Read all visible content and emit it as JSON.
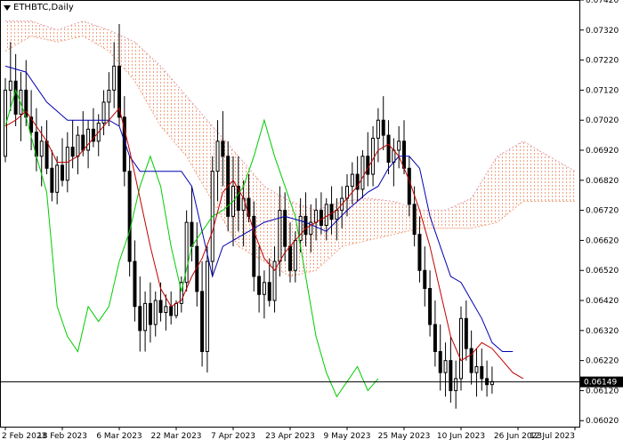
{
  "chart_data": {
    "type": "candlestick",
    "symbol_label": "ETHBTC,Daily",
    "current_price_label": "0.06149",
    "current_price": 0.06149,
    "ylim": [
      0.06,
      0.0742
    ],
    "y_ticks": [
      "0.07420",
      "0.07320",
      "0.07220",
      "0.07120",
      "0.07020",
      "0.06920",
      "0.06820",
      "0.06720",
      "0.06620",
      "0.06520",
      "0.06420",
      "0.06320",
      "0.06220",
      "0.06120",
      "0.06020"
    ],
    "x_ticks": [
      "2 Feb 2023",
      "18 Feb 2023",
      "6 Mar 2023",
      "22 Mar 2023",
      "7 Apr 2023",
      "23 Apr 2023",
      "9 May 2023",
      "25 May 2023",
      "10 Jun 2023",
      "26 Jun 2023",
      "12 Jul 2023"
    ],
    "x_tick_index": [
      0,
      11,
      22,
      33,
      44,
      55,
      66,
      77,
      88,
      99,
      110
    ],
    "colors": {
      "candle": "#000000",
      "tenkan": "#c00000",
      "kijun": "#0000b0",
      "chikou": "#00cc00",
      "cloud_a": "#f0a080",
      "cloud_b": "#e0a0b0"
    },
    "candles": [
      [
        0.069,
        0.0716,
        0.0688,
        0.0712
      ],
      [
        0.0712,
        0.0728,
        0.0705,
        0.0715
      ],
      [
        0.0715,
        0.0724,
        0.07,
        0.0704
      ],
      [
        0.0704,
        0.0718,
        0.0695,
        0.0712
      ],
      [
        0.0712,
        0.0722,
        0.07,
        0.0703
      ],
      [
        0.0703,
        0.0712,
        0.0692,
        0.0698
      ],
      [
        0.0698,
        0.0706,
        0.0685,
        0.069
      ],
      [
        0.069,
        0.07,
        0.068,
        0.0695
      ],
      [
        0.0695,
        0.0702,
        0.0684,
        0.0686
      ],
      [
        0.0686,
        0.0692,
        0.0675,
        0.0678
      ],
      [
        0.0678,
        0.069,
        0.0674,
        0.0687
      ],
      [
        0.0687,
        0.0696,
        0.068,
        0.0682
      ],
      [
        0.0682,
        0.0698,
        0.0678,
        0.0693
      ],
      [
        0.0693,
        0.0702,
        0.0686,
        0.069
      ],
      [
        0.069,
        0.07,
        0.0684,
        0.0697
      ],
      [
        0.0697,
        0.0705,
        0.069,
        0.0692
      ],
      [
        0.0692,
        0.0702,
        0.0686,
        0.0699
      ],
      [
        0.0699,
        0.0706,
        0.0693,
        0.0695
      ],
      [
        0.0695,
        0.0704,
        0.069,
        0.0701
      ],
      [
        0.0701,
        0.0712,
        0.0697,
        0.0708
      ],
      [
        0.0708,
        0.0718,
        0.07,
        0.0712
      ],
      [
        0.0712,
        0.0728,
        0.0706,
        0.072
      ],
      [
        0.072,
        0.0734,
        0.07,
        0.0703
      ],
      [
        0.0703,
        0.071,
        0.068,
        0.0685
      ],
      [
        0.0685,
        0.069,
        0.065,
        0.0655
      ],
      [
        0.0655,
        0.0662,
        0.0635,
        0.064
      ],
      [
        0.064,
        0.065,
        0.0625,
        0.0632
      ],
      [
        0.0632,
        0.0645,
        0.0625,
        0.0641
      ],
      [
        0.0641,
        0.0648,
        0.0628,
        0.0634
      ],
      [
        0.0634,
        0.0645,
        0.063,
        0.0642
      ],
      [
        0.0642,
        0.0648,
        0.0635,
        0.0638
      ],
      [
        0.0638,
        0.0644,
        0.0632,
        0.064
      ],
      [
        0.064,
        0.0645,
        0.0634,
        0.0637
      ],
      [
        0.0637,
        0.0642,
        0.0636,
        0.0641
      ],
      [
        0.0641,
        0.065,
        0.0638,
        0.0648
      ],
      [
        0.0648,
        0.0672,
        0.0645,
        0.0668
      ],
      [
        0.0668,
        0.068,
        0.0655,
        0.066
      ],
      [
        0.066,
        0.0668,
        0.064,
        0.0645
      ],
      [
        0.0645,
        0.0655,
        0.062,
        0.0625
      ],
      [
        0.0625,
        0.066,
        0.0618,
        0.0655
      ],
      [
        0.0655,
        0.069,
        0.065,
        0.0685
      ],
      [
        0.0685,
        0.0702,
        0.0675,
        0.0695
      ],
      [
        0.0695,
        0.0705,
        0.068,
        0.069
      ],
      [
        0.069,
        0.0695,
        0.0665,
        0.067
      ],
      [
        0.067,
        0.069,
        0.066,
        0.068
      ],
      [
        0.068,
        0.069,
        0.0665,
        0.0672
      ],
      [
        0.0672,
        0.0682,
        0.066,
        0.0676
      ],
      [
        0.0676,
        0.0684,
        0.0668,
        0.067
      ],
      [
        0.067,
        0.0675,
        0.0645,
        0.065
      ],
      [
        0.065,
        0.066,
        0.0638,
        0.0644
      ],
      [
        0.0644,
        0.0652,
        0.0636,
        0.0648
      ],
      [
        0.0648,
        0.0656,
        0.064,
        0.0642
      ],
      [
        0.0642,
        0.066,
        0.0638,
        0.0655
      ],
      [
        0.0655,
        0.068,
        0.065,
        0.0672
      ],
      [
        0.0672,
        0.0678,
        0.0655,
        0.066
      ],
      [
        0.066,
        0.0668,
        0.0648,
        0.0652
      ],
      [
        0.0652,
        0.0665,
        0.0648,
        0.0662
      ],
      [
        0.0662,
        0.0676,
        0.0658,
        0.067
      ],
      [
        0.067,
        0.0678,
        0.066,
        0.0664
      ],
      [
        0.0664,
        0.0674,
        0.0658,
        0.0668
      ],
      [
        0.0668,
        0.0676,
        0.0662,
        0.0672
      ],
      [
        0.0672,
        0.0678,
        0.0664,
        0.0667
      ],
      [
        0.0667,
        0.0676,
        0.0662,
        0.0674
      ],
      [
        0.0674,
        0.068,
        0.0664,
        0.0669
      ],
      [
        0.0669,
        0.0676,
        0.0662,
        0.0672
      ],
      [
        0.0672,
        0.068,
        0.0666,
        0.0676
      ],
      [
        0.0676,
        0.0684,
        0.067,
        0.068
      ],
      [
        0.068,
        0.0688,
        0.0674,
        0.0684
      ],
      [
        0.0684,
        0.069,
        0.0675,
        0.0679
      ],
      [
        0.0679,
        0.0692,
        0.0676,
        0.069
      ],
      [
        0.069,
        0.0698,
        0.068,
        0.0684
      ],
      [
        0.0684,
        0.07,
        0.068,
        0.0696
      ],
      [
        0.0696,
        0.0706,
        0.0688,
        0.0702
      ],
      [
        0.0702,
        0.071,
        0.0692,
        0.0697
      ],
      [
        0.0697,
        0.0702,
        0.0684,
        0.0688
      ],
      [
        0.0688,
        0.0696,
        0.068,
        0.0692
      ],
      [
        0.0692,
        0.07,
        0.0686,
        0.0695
      ],
      [
        0.0695,
        0.0702,
        0.0684,
        0.0686
      ],
      [
        0.0686,
        0.069,
        0.067,
        0.0674
      ],
      [
        0.0674,
        0.068,
        0.066,
        0.0664
      ],
      [
        0.0664,
        0.067,
        0.0648,
        0.0652
      ],
      [
        0.0652,
        0.066,
        0.064,
        0.0646
      ],
      [
        0.0646,
        0.0652,
        0.063,
        0.0634
      ],
      [
        0.0634,
        0.0642,
        0.062,
        0.0625
      ],
      [
        0.0625,
        0.0634,
        0.0612,
        0.0618
      ],
      [
        0.0618,
        0.0628,
        0.061,
        0.0622
      ],
      [
        0.0622,
        0.063,
        0.0608,
        0.0612
      ],
      [
        0.0612,
        0.0622,
        0.0606,
        0.0616
      ],
      [
        0.0616,
        0.064,
        0.0612,
        0.0636
      ],
      [
        0.0636,
        0.0642,
        0.0622,
        0.0626
      ],
      [
        0.0626,
        0.0632,
        0.0614,
        0.0618
      ],
      [
        0.0618,
        0.0626,
        0.061,
        0.062
      ],
      [
        0.062,
        0.0626,
        0.0612,
        0.0616
      ],
      [
        0.0616,
        0.0622,
        0.061,
        0.0614
      ],
      [
        0.0614,
        0.062,
        0.0611,
        0.0615
      ]
    ],
    "tenkan": [
      [
        0,
        0.07
      ],
      [
        2,
        0.0702
      ],
      [
        4,
        0.0705
      ],
      [
        6,
        0.07
      ],
      [
        8,
        0.0695
      ],
      [
        10,
        0.0688
      ],
      [
        12,
        0.0688
      ],
      [
        14,
        0.069
      ],
      [
        16,
        0.0694
      ],
      [
        18,
        0.0698
      ],
      [
        20,
        0.0702
      ],
      [
        22,
        0.0706
      ],
      [
        24,
        0.0692
      ],
      [
        26,
        0.0676
      ],
      [
        28,
        0.066
      ],
      [
        30,
        0.0646
      ],
      [
        32,
        0.064
      ],
      [
        34,
        0.0642
      ],
      [
        36,
        0.065
      ],
      [
        38,
        0.0656
      ],
      [
        40,
        0.0665
      ],
      [
        42,
        0.0678
      ],
      [
        44,
        0.0682
      ],
      [
        46,
        0.0676
      ],
      [
        48,
        0.0665
      ],
      [
        50,
        0.0656
      ],
      [
        52,
        0.0652
      ],
      [
        54,
        0.0658
      ],
      [
        56,
        0.0662
      ],
      [
        58,
        0.0666
      ],
      [
        60,
        0.0668
      ],
      [
        62,
        0.067
      ],
      [
        64,
        0.0672
      ],
      [
        66,
        0.0676
      ],
      [
        68,
        0.068
      ],
      [
        70,
        0.0686
      ],
      [
        72,
        0.0692
      ],
      [
        74,
        0.0694
      ],
      [
        76,
        0.069
      ],
      [
        78,
        0.0682
      ],
      [
        80,
        0.0672
      ],
      [
        82,
        0.066
      ],
      [
        84,
        0.0645
      ],
      [
        86,
        0.063
      ],
      [
        88,
        0.0622
      ],
      [
        90,
        0.0624
      ],
      [
        92,
        0.0628
      ],
      [
        94,
        0.0626
      ],
      [
        96,
        0.0622
      ],
      [
        98,
        0.0618
      ],
      [
        100,
        0.0616
      ]
    ],
    "kijun": [
      [
        0,
        0.072
      ],
      [
        4,
        0.0718
      ],
      [
        8,
        0.0708
      ],
      [
        12,
        0.0702
      ],
      [
        16,
        0.0702
      ],
      [
        20,
        0.0702
      ],
      [
        22,
        0.07
      ],
      [
        24,
        0.069
      ],
      [
        26,
        0.0685
      ],
      [
        30,
        0.0685
      ],
      [
        34,
        0.0685
      ],
      [
        36,
        0.068
      ],
      [
        38,
        0.0665
      ],
      [
        40,
        0.065
      ],
      [
        42,
        0.066
      ],
      [
        46,
        0.0664
      ],
      [
        50,
        0.0668
      ],
      [
        54,
        0.067
      ],
      [
        58,
        0.0668
      ],
      [
        62,
        0.0665
      ],
      [
        66,
        0.0672
      ],
      [
        70,
        0.0678
      ],
      [
        72,
        0.068
      ],
      [
        74,
        0.0686
      ],
      [
        76,
        0.069
      ],
      [
        78,
        0.069
      ],
      [
        80,
        0.0686
      ],
      [
        82,
        0.067
      ],
      [
        84,
        0.066
      ],
      [
        86,
        0.065
      ],
      [
        88,
        0.0648
      ],
      [
        90,
        0.0642
      ],
      [
        92,
        0.0636
      ],
      [
        94,
        0.0628
      ],
      [
        96,
        0.0625
      ],
      [
        98,
        0.0625
      ]
    ],
    "chikou": [
      [
        0,
        0.07
      ],
      [
        2,
        0.0712
      ],
      [
        4,
        0.0703
      ],
      [
        6,
        0.069
      ],
      [
        8,
        0.0678
      ],
      [
        10,
        0.064
      ],
      [
        12,
        0.063
      ],
      [
        14,
        0.0625
      ],
      [
        16,
        0.064
      ],
      [
        18,
        0.0635
      ],
      [
        20,
        0.064
      ],
      [
        22,
        0.0655
      ],
      [
        24,
        0.0665
      ],
      [
        26,
        0.068
      ],
      [
        28,
        0.069
      ],
      [
        30,
        0.068
      ],
      [
        32,
        0.066
      ],
      [
        34,
        0.0645
      ],
      [
        36,
        0.066
      ],
      [
        38,
        0.0665
      ],
      [
        40,
        0.067
      ],
      [
        42,
        0.0672
      ],
      [
        44,
        0.0675
      ],
      [
        46,
        0.068
      ],
      [
        48,
        0.069
      ],
      [
        50,
        0.0702
      ],
      [
        52,
        0.069
      ],
      [
        54,
        0.068
      ],
      [
        56,
        0.067
      ],
      [
        58,
        0.065
      ],
      [
        60,
        0.063
      ],
      [
        62,
        0.0618
      ],
      [
        64,
        0.061
      ],
      [
        66,
        0.0615
      ],
      [
        68,
        0.062
      ],
      [
        70,
        0.0612
      ],
      [
        72,
        0.0616
      ]
    ],
    "cloud": [
      [
        0,
        0.0725,
        0.0735
      ],
      [
        5,
        0.073,
        0.0735
      ],
      [
        10,
        0.0728,
        0.0732
      ],
      [
        15,
        0.073,
        0.0735
      ],
      [
        20,
        0.0725,
        0.0732
      ],
      [
        25,
        0.0715,
        0.0728
      ],
      [
        30,
        0.07,
        0.072
      ],
      [
        35,
        0.069,
        0.071
      ],
      [
        40,
        0.0675,
        0.07
      ],
      [
        45,
        0.066,
        0.069
      ],
      [
        50,
        0.0655,
        0.068
      ],
      [
        55,
        0.065,
        0.0675
      ],
      [
        60,
        0.0652,
        0.0672
      ],
      [
        65,
        0.066,
        0.0675
      ],
      [
        70,
        0.0662,
        0.0676
      ],
      [
        75,
        0.0664,
        0.0675
      ],
      [
        80,
        0.0666,
        0.0672
      ],
      [
        85,
        0.0666,
        0.0672
      ],
      [
        90,
        0.0666,
        0.0676
      ],
      [
        95,
        0.0668,
        0.069
      ],
      [
        100,
        0.0675,
        0.0695
      ],
      [
        105,
        0.0675,
        0.069
      ],
      [
        110,
        0.0675,
        0.0685
      ]
    ]
  }
}
